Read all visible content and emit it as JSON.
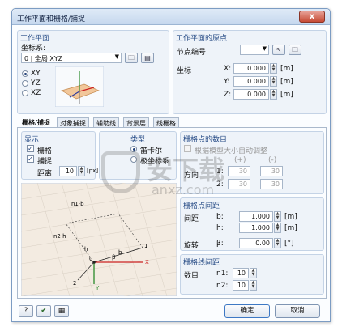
{
  "window": {
    "title": "工作平面和栅格/捕捉",
    "close": "x"
  },
  "work_plane": {
    "header": "工作平面",
    "coord_label": "坐标系:",
    "coord_value": "0 | 全局 XYZ",
    "planes": [
      "XY",
      "YZ",
      "XZ"
    ],
    "selected_plane": "XY"
  },
  "origin": {
    "header": "工作平面的原点",
    "node_label": "节点编号:",
    "coords_label": "坐标",
    "rows": [
      {
        "axis": "X:",
        "value": "0.000",
        "unit": "[m]"
      },
      {
        "axis": "Y:",
        "value": "0.000",
        "unit": "[m]"
      },
      {
        "axis": "Z:",
        "value": "0.000",
        "unit": "[m]"
      }
    ]
  },
  "tabs": [
    "栅格/捕捉",
    "对象捕捉",
    "辅助线",
    "背景层",
    "线栅格"
  ],
  "active_tab": "栅格/捕捉",
  "display": {
    "header": "显示",
    "grid_label": "栅格",
    "snap_label": "捕捉",
    "distance_label": "距离:",
    "distance_value": "10",
    "distance_unit": "[px]"
  },
  "type": {
    "header": "类型",
    "options": [
      "笛卡尔",
      "极坐标系"
    ]
  },
  "grid_points": {
    "header": "栅格点的数目",
    "auto_label": "根据模型大小自动调整",
    "direction_label": "方向",
    "col_plus": "(+)",
    "col_minus": "(-)",
    "rows": [
      {
        "axis": "1:",
        "plus": "30",
        "minus": "30"
      },
      {
        "axis": "2:",
        "plus": "30",
        "minus": "30"
      }
    ]
  },
  "grid_spacing": {
    "header": "栅格点间距",
    "spacing_label": "间距",
    "b_label": "b:",
    "b_value": "1.000",
    "h_label": "h:",
    "h_value": "1.000",
    "unit": "[m]",
    "rotation_label": "旋转",
    "beta_label": "β:",
    "beta_value": "0.00",
    "beta_unit": "[°]"
  },
  "line_spacing": {
    "header": "栅格线间距",
    "count_label": "数目",
    "n1_label": "n1:",
    "n1_value": "10",
    "n2_label": "n2:",
    "n2_value": "10"
  },
  "diagram": {
    "labels": [
      "b",
      "h",
      "n1·b",
      "n2·h",
      "X",
      "Y",
      "0",
      "1",
      "2",
      "β"
    ]
  },
  "footer": {
    "ok": "确定",
    "cancel": "取消",
    "help": "?",
    "ok_icon": "✔",
    "print": "▦"
  },
  "watermark": {
    "big": "安下载",
    "small": "anxz.com"
  }
}
